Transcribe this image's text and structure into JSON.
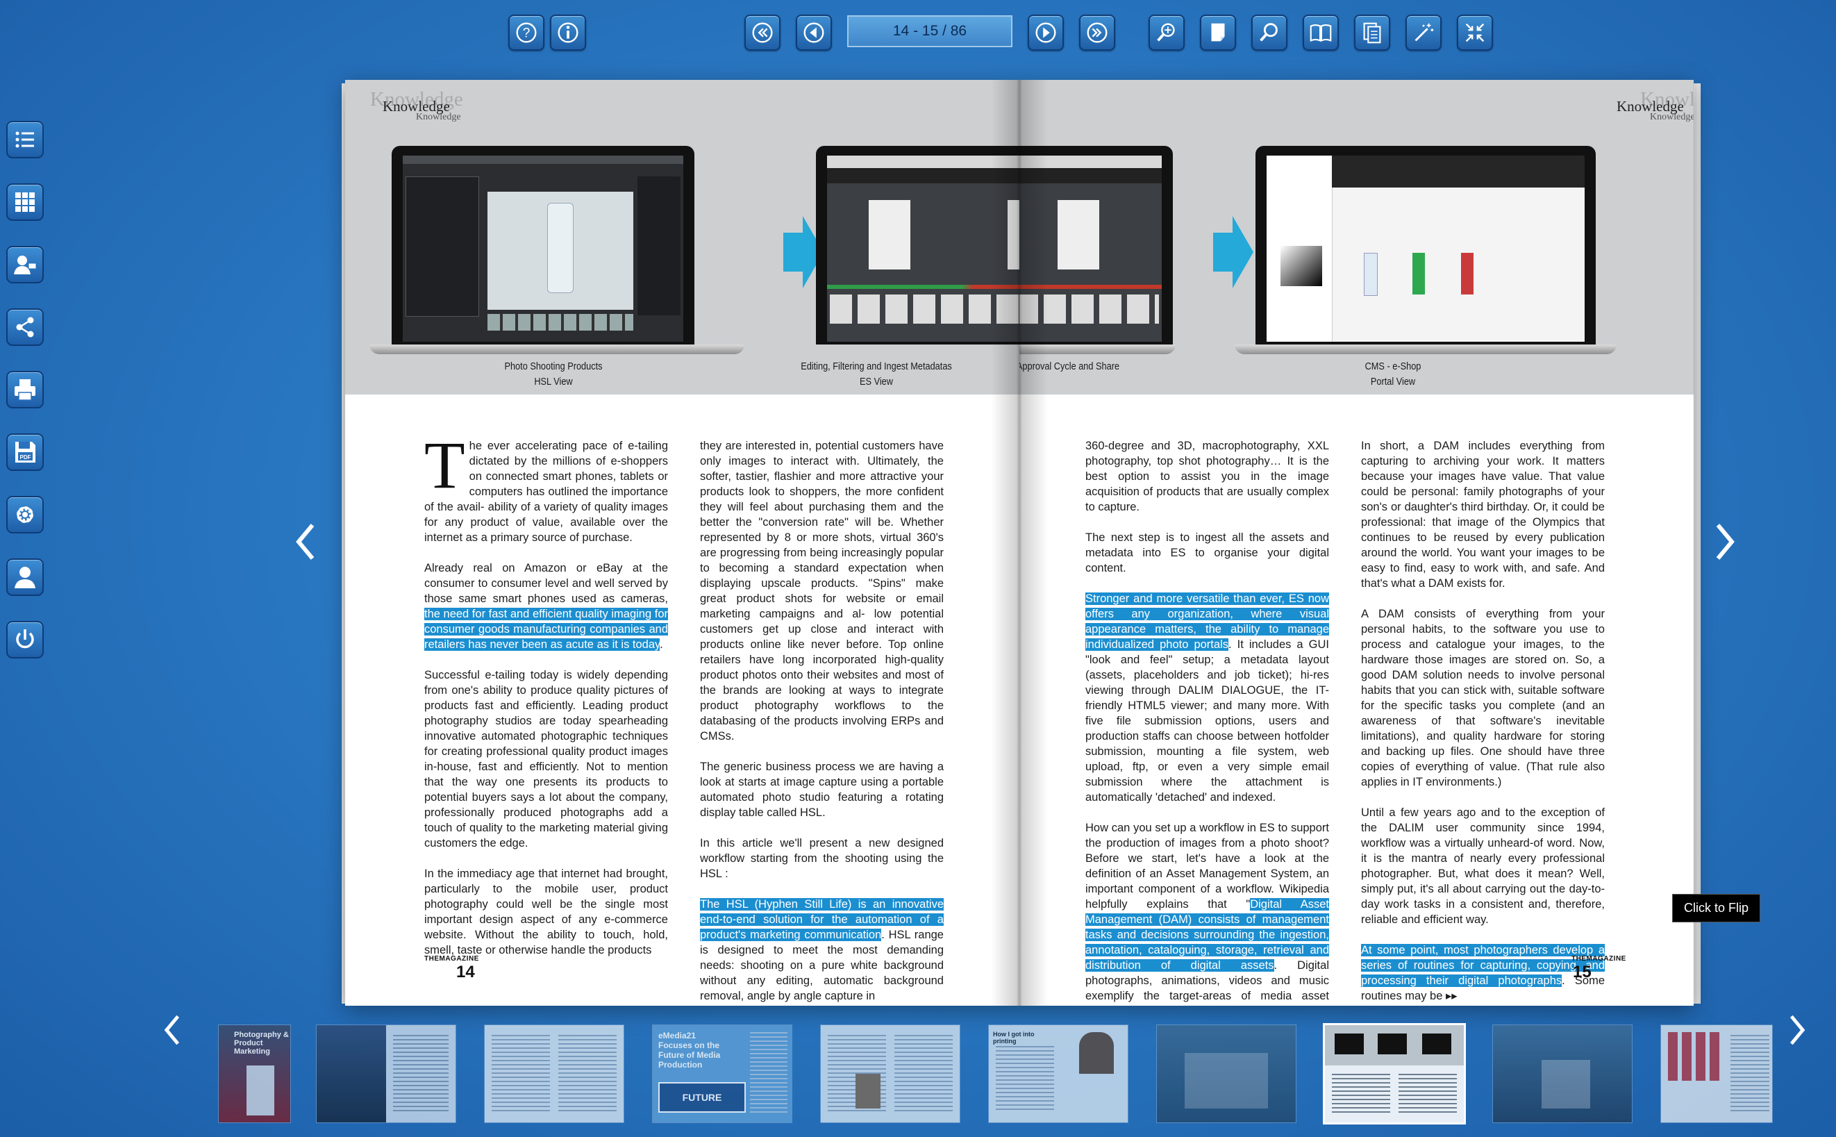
{
  "toolbar": {
    "help": "help-icon",
    "info": "info-icon",
    "first": "first-page-icon",
    "prev": "previous-page-icon",
    "page_indicator": "14 - 15 / 86",
    "next": "next-page-icon",
    "last": "last-page-icon",
    "zoom": "zoom-in-icon",
    "single_page": "single-page-icon",
    "search": "search-icon",
    "book_view": "book-view-icon",
    "copy": "copy-icon",
    "magic": "magic-wand-icon",
    "fullscreen": "fullscreen-icon"
  },
  "sidebar": [
    {
      "name": "table-of-contents-icon"
    },
    {
      "name": "thumbnails-icon"
    },
    {
      "name": "contact-icon"
    },
    {
      "name": "share-icon"
    },
    {
      "name": "print-icon"
    },
    {
      "name": "pdf-download-icon"
    },
    {
      "name": "settings-icon"
    },
    {
      "name": "user-icon"
    },
    {
      "name": "power-icon"
    }
  ],
  "header": {
    "brand": "Knowledge",
    "brand_small": "Knowledge"
  },
  "workflow": {
    "captions": [
      {
        "line1": "Photo Shooting Products",
        "line2": "HSL View"
      },
      {
        "line1": "Editing, Filtering and Ingest Metadatas",
        "line2": "ES View"
      },
      {
        "line1": "Approval Cycle and Share",
        "line2": ""
      },
      {
        "line1": "CMS - e-Shop",
        "line2": "Portal View"
      }
    ]
  },
  "article": {
    "p1_dropcap": "T",
    "p1_text": "he ever accelerating pace of e-tailing dictated by the millions of e-shoppers on connected smart phones, tablets or computers has outlined the importance of the avail- ability of a variety of quality images for any product of value, available over the internet as a primary source of purchase.",
    "p2_a": "Already real on Amazon or eBay at the consumer to consumer level and well served by those same smart phones used as cameras, ",
    "p2_hl": "the need for fast and efficient quality imaging for consumer goods manufacturing companies and retailers has never been as acute as it is today",
    "p2_b": ".",
    "p3": "Successful e-tailing today is widely depending from one's ability to produce quality pictures of products fast and efficiently. Leading product photography studios are today spearheading innovative automated photographic techniques for creating professional quality product images in-house, fast and efficiently. Not to mention that the way one presents its products to potential buyers says a lot about the company, professionally produced photographs add a touch of quality to the marketing material giving customers the edge.",
    "p4": "In the immediacy age that internet had brought, particularly to the mobile user, product photography could well be the single most important design aspect of any e-commerce website. Without the ability to touch, hold, smell, taste or otherwise handle the products",
    "c2_p1": "they are interested in, potential customers have only images to interact with. Ultimately, the softer, tastier, flashier and more attractive your products look to shoppers, the more confident they will feel about purchasing them and the better the \"conversion rate\" will be. Whether represented by 8 or more shots, virtual 360's are progressing from being increasingly popular to becoming a standard expectation when displaying upscale products. \"Spins\" make great product shots for website or email marketing campaigns and al- low potential customers get up close and interact with products online like never before. Top online retailers have long incorporated high-quality product photos onto their websites and most of the brands are looking at ways to integrate product photography workflows to the databasing of the products involving ERPs and CMSs.",
    "c2_p2": "The generic business process we are having a look at starts at image capture using a portable automated photo studio featuring a rotating display table called HSL.",
    "c2_p3": "In this article we'll present a new designed workflow starting from the shooting using the HSL :",
    "c2_p4_hl": "The HSL (Hyphen Still Life) is an innovative end-to-end solution for the automation of a product's marketing communication",
    "c2_p4_b": ". HSL range is designed to meet the most demanding needs: shooting on a pure white background without any editing, automatic background removal, angle by angle capture in",
    "c3_p1": "360-degree and 3D, macrophotography, XXL photography, top shot photography… It is the best option to assist you in the image acquisition of products that are usually complex to capture.",
    "c3_p2": "The next step is to ingest all the assets and metadata into ES to organise your digital content.",
    "c3_p3_hl": "Stronger and more versatile than ever, ES now offers any organization, where visual appearance matters, the ability to manage individualized photo portals",
    "c3_p3_b": ". It includes a GUI \"look and feel\" setup; a metadata layout (assets, placeholders and job ticket); hi-res viewing through DALIM DIALOGUE, the IT-friendly HTML5 viewer; and many more. With five file submission options, users and production staffs can choose between hotfolder submission, mounting a file system, web upload, ftp, or even a very simple email submission where the attachment is automatically 'detached' and indexed.",
    "c3_p4_a": "How can you set up a workflow in ES to support the production of images from a photo shoot? Before we start, let's have a look at the definition of an Asset Management System, an important component of a workflow. Wikipedia helpfully explains that \"",
    "c3_p4_hl": "Digital Asset Management (DAM) consists of management tasks and decisions surrounding the ingestion, annotation, cataloguing, storage, retrieval and distribution of digital assets",
    "c3_p4_b": ". Digital photographs, animations, videos and music exemplify the target-areas of media asset management (a sub-category of DAM).\"",
    "c4_p1": "In short, a DAM includes everything from capturing to archiving your work. It matters because your images have value. That value could be personal: family photographs of your son's or daughter's third birthday. Or, it could be professional: that image of the Olympics that continues to be reused by every publication around the world. You want your images to be easy to find, easy to work with, and safe. And that's what a DAM exists for.",
    "c4_p2": "A DAM consists of everything from your personal habits, to the software you use to process and catalogue your images, to the hardware those images are stored on. So, a good DAM solution needs to involve personal habits that you can stick with, suitable software for the specific tasks you complete (and an awareness of that software's inevitable limitations), and quality hardware for storing and backing up files. One should have three copies of everything of value. (That rule also applies in IT environments.)",
    "c4_p3": "Until a few years ago and to the exception of the DALIM user community since 1994, workflow was a virtually unheard-of word. Now, it is the mantra of nearly every professional photographer. But, what does it mean? Well, simply put, it's all about carrying out the day-to-day work tasks in a consistent and, therefore, reliable and efficient way.",
    "c4_p4_hl": "At some point, most photographers develop a series of routines for capturing, copying, and processing their digital photographs",
    "c4_p4_b": ". Some routines may be",
    "c4_more": "▸▸"
  },
  "footer": {
    "magazine": "THEMAGAZINE",
    "left_page": "14",
    "right_page": "15"
  },
  "tooltip": "Click to Flip",
  "thumbnails": [
    {
      "label": "Photography & Product Marketing"
    },
    {
      "label": ""
    },
    {
      "label": ""
    },
    {
      "label": "eMedia21 Focuses on the Future of Media Production",
      "sign": "FUTURE"
    },
    {
      "label": ""
    },
    {
      "label": "How I got into printing"
    },
    {
      "label": ""
    },
    {
      "label": ""
    },
    {
      "label": ""
    },
    {
      "label": ""
    }
  ],
  "colors": {
    "accent": "#1b8ed0",
    "background": "#2a78c2",
    "arrow": "#25a9d8"
  }
}
